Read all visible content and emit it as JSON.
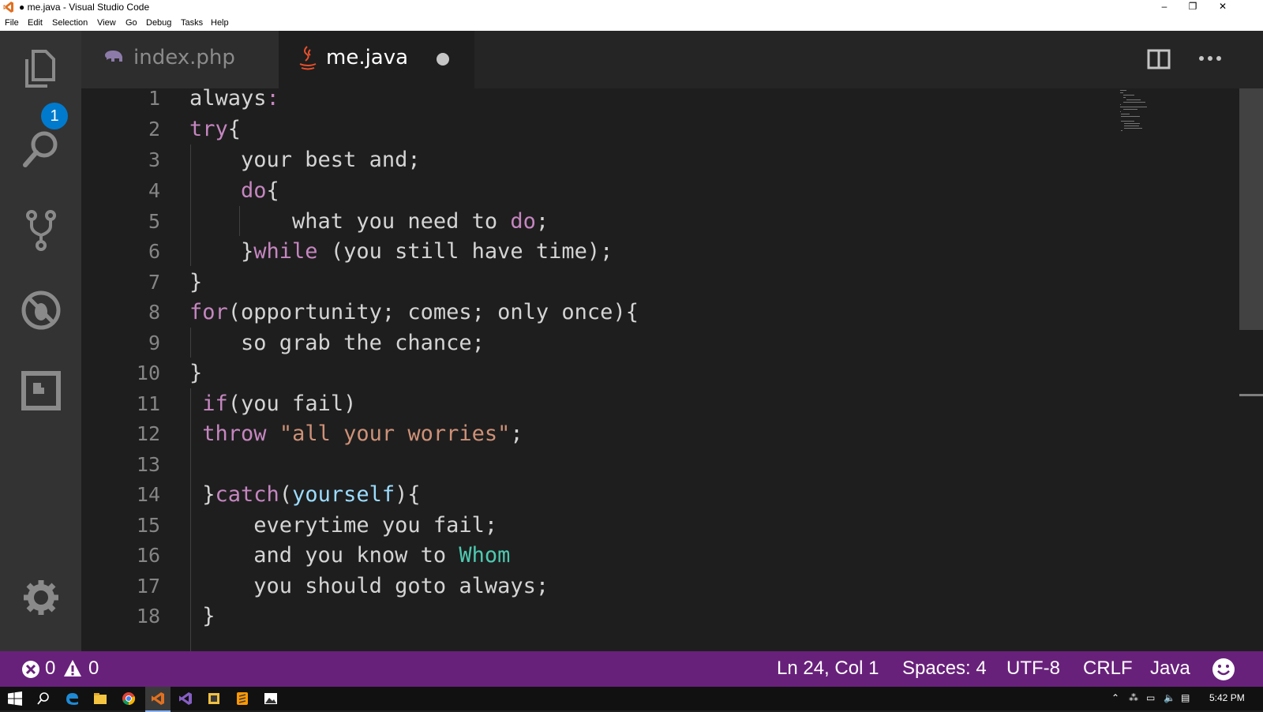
{
  "window": {
    "title": "● me.java - Visual Studio Code",
    "minimize": "–",
    "restore": "❐",
    "close": "✕"
  },
  "menu": [
    "File",
    "Edit",
    "Selection",
    "View",
    "Go",
    "Debug",
    "Tasks",
    "Help"
  ],
  "activity_bar": {
    "explorer_badge": "1",
    "items": [
      "explorer",
      "search",
      "source-control",
      "debug",
      "extensions",
      "settings"
    ]
  },
  "tabs": [
    {
      "label": "index.php",
      "active": false,
      "icon": "php-elephant-icon"
    },
    {
      "label": "me.java",
      "active": true,
      "dirty": true,
      "icon": "java-cup-icon"
    }
  ],
  "editor": {
    "line_numbers": [
      "1",
      "2",
      "3",
      "4",
      "5",
      "6",
      "7",
      "8",
      "9",
      "10",
      "11",
      "12",
      "13",
      "14",
      "15",
      "16",
      "17",
      "18"
    ],
    "lines": [
      "always:",
      "try{",
      "    your best and;",
      "    do{",
      "        what you need to do;",
      "    }while (you still have time);",
      "}",
      "for(opportunity; comes; only once){",
      "    so grab the chance;",
      "}",
      " if(you fail)",
      " throw \"all your worries\";",
      "",
      " }catch(yourself){",
      "     everytime you fail;",
      "     and you know to Whom",
      "     you should goto always;",
      " }"
    ]
  },
  "status_bar": {
    "errors": "0",
    "warnings": "0",
    "position": "Ln 24, Col 1",
    "spaces": "Spaces: 4",
    "encoding": "UTF-8",
    "eol": "CRLF",
    "language": "Java"
  },
  "taskbar": {
    "clock": "5:42 PM"
  },
  "colors": {
    "status_bar": "#68217a",
    "keyword": "#c586c0",
    "string": "#ce9178",
    "type": "#4ec9b0",
    "variable": "#9cdcfe"
  }
}
